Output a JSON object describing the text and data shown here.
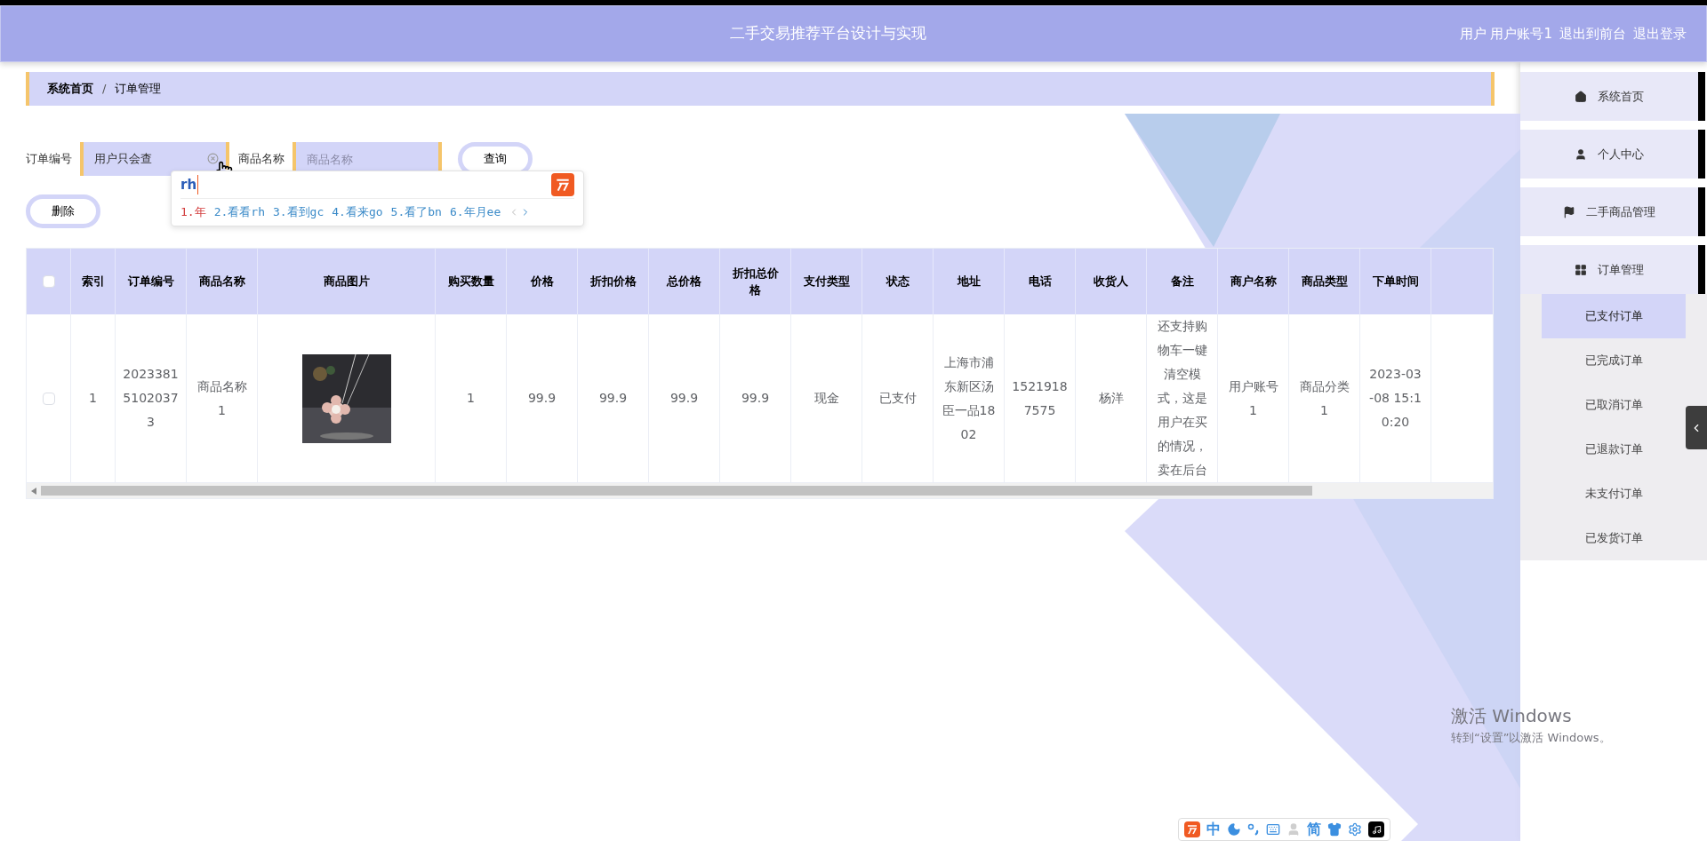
{
  "header": {
    "title": "二手交易推荐平台设计与实现",
    "user_items": [
      "用户 用户账号1",
      "退出到前台",
      "退出登录"
    ]
  },
  "breadcrumb": {
    "items": [
      "系统首页",
      "订单管理"
    ],
    "separator": "/"
  },
  "search": {
    "fields": [
      {
        "label": "订单编号",
        "value": "用户只会查"
      },
      {
        "label": "商品名称",
        "placeholder": "商品名称"
      }
    ],
    "button": "查询"
  },
  "delete_button": "删除",
  "ime": {
    "input": "rh",
    "candidates": [
      {
        "text": "1.年",
        "selected": true
      },
      {
        "text": "2.看看rh",
        "selected": false
      },
      {
        "text": "3.看到gc",
        "selected": false
      },
      {
        "text": "4.看来go",
        "selected": false
      },
      {
        "text": "5.看了bn",
        "selected": false
      },
      {
        "text": "6.年月ee",
        "selected": false
      }
    ]
  },
  "table": {
    "columns": [
      {
        "kind": "checkbox",
        "checked": false
      },
      {
        "label": "索引"
      },
      {
        "label": "订单编号"
      },
      {
        "label": "商品名称"
      },
      {
        "label": "商品图片"
      },
      {
        "label": "购买数量"
      },
      {
        "label": "价格"
      },
      {
        "label": "折扣价格"
      },
      {
        "label": "总价格"
      },
      {
        "label": "折扣总价格"
      },
      {
        "label": "支付类型"
      },
      {
        "label": "状态"
      },
      {
        "label": "地址"
      },
      {
        "label": "电话"
      },
      {
        "label": "收货人"
      },
      {
        "label": "备注"
      },
      {
        "label": "商户名称"
      },
      {
        "label": "商品类型"
      },
      {
        "label": "下单时间"
      }
    ],
    "rows": [
      {
        "cells": [
          {
            "kind": "checkbox",
            "checked": false
          },
          {
            "text": "1"
          },
          {
            "text": "202338151020373"
          },
          {
            "text": "商品名称1"
          },
          {
            "kind": "picture"
          },
          {
            "text": "1"
          },
          {
            "text": "99.9"
          },
          {
            "text": "99.9"
          },
          {
            "text": "99.9"
          },
          {
            "text": "99.9"
          },
          {
            "text": "现金"
          },
          {
            "text": "已支付"
          },
          {
            "text": "上海市浦东新区汤臣一品1802"
          },
          {
            "text": "15219187575"
          },
          {
            "text": "杨洋"
          },
          {
            "text": "还支持购物车一键清空模式，这是用户在买的情况，卖在后台"
          },
          {
            "text": "用户账号1"
          },
          {
            "text": "商品分类1"
          },
          {
            "text": "2023-03-08 15:10:20"
          }
        ]
      }
    ]
  },
  "sidebar": {
    "items": [
      {
        "label": "系统首页"
      },
      {
        "label": "个人中心"
      },
      {
        "label": "二手商品管理"
      },
      {
        "label": "订单管理",
        "expanded": true,
        "children": [
          {
            "label": "已支付订单",
            "selected": true
          },
          {
            "label": "已完成订单",
            "selected": false
          },
          {
            "label": "已取消订单",
            "selected": false
          },
          {
            "label": "已退款订单",
            "selected": false
          },
          {
            "label": "未支付订单",
            "selected": false
          },
          {
            "label": "已发货订单",
            "selected": false
          }
        ]
      }
    ]
  },
  "os_notice": {
    "title": "激活 Windows",
    "subtitle": "转到“设置”以激活 Windows。"
  },
  "ime_toolbar": [
    {
      "kind": "logo"
    },
    {
      "kind": "text",
      "text": "中"
    },
    {
      "kind": "moon"
    },
    {
      "kind": "punctuation"
    },
    {
      "kind": "keyboard"
    },
    {
      "kind": "person"
    },
    {
      "kind": "text",
      "text": "简"
    },
    {
      "kind": "shirt"
    },
    {
      "kind": "gear"
    },
    {
      "kind": "music"
    }
  ]
}
